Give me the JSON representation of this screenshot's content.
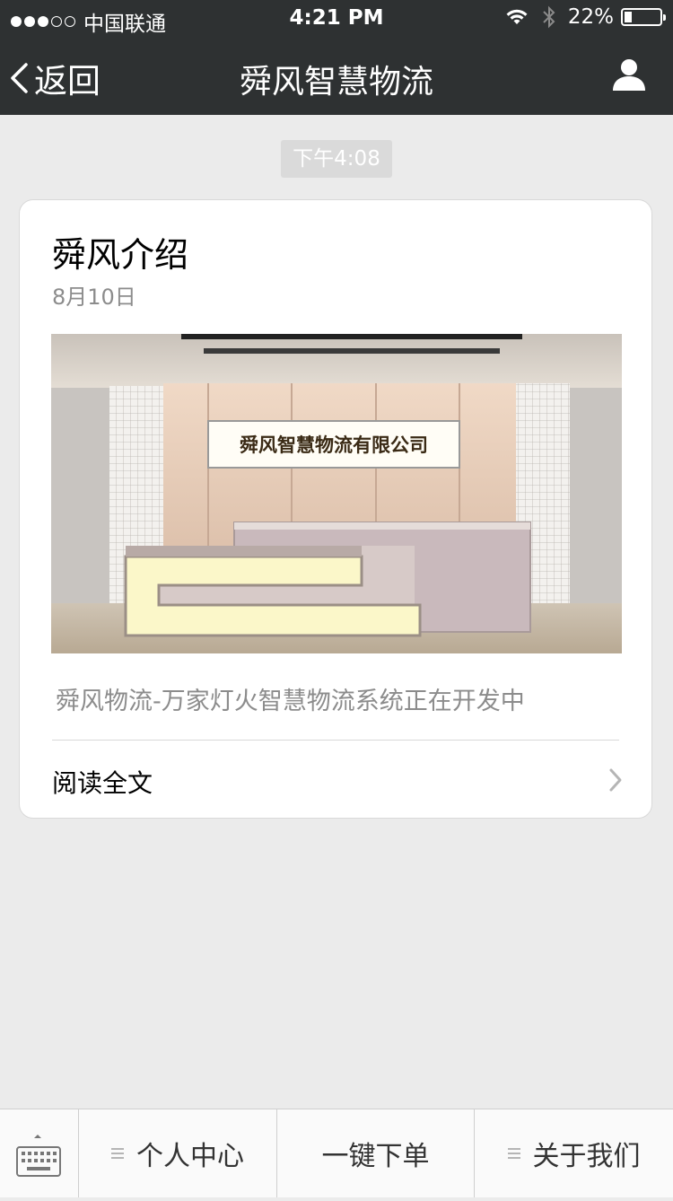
{
  "status_bar": {
    "carrier": "中国联通",
    "time": "4:21 PM",
    "battery": "22%",
    "battery_level": 0.22,
    "signal_dots_filled": 3,
    "signal_dots_total": 5
  },
  "nav": {
    "back_label": "返回",
    "title": "舜风智慧物流",
    "back_icon": "chevron-left-icon",
    "profile_icon": "user-icon"
  },
  "chat": {
    "timestamp": "下午4:08"
  },
  "article": {
    "title": "舜风介绍",
    "date": "8月10日",
    "sign_text": "舜风智慧物流有限公司",
    "description": "舜风物流-万家灯火智慧物流系统正在开发中",
    "read_more": "阅读全文"
  },
  "bottom_menu": {
    "keyboard_icon": "keyboard-icon",
    "items": [
      {
        "label": "个人中心"
      },
      {
        "label": "一键下单"
      },
      {
        "label": "关于我们"
      }
    ]
  },
  "colors": {
    "nav_bg": "#2e3132",
    "page_bg": "#ebebeb",
    "menu_bg": "#fafafa"
  }
}
